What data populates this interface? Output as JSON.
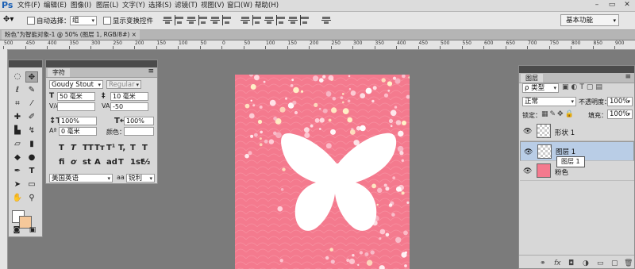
{
  "app": {
    "logo": "Ps"
  },
  "menu": [
    "文件(F)",
    "编辑(E)",
    "图像(I)",
    "图层(L)",
    "文字(Y)",
    "选择(S)",
    "滤镜(T)",
    "视图(V)",
    "窗口(W)",
    "帮助(H)"
  ],
  "window_controls": [
    "–",
    "▭",
    "✕"
  ],
  "options": {
    "auto_select_label": "自动选择：",
    "auto_select_value": "组",
    "transform_label": "显示变换控件",
    "workspace": "基本功能"
  },
  "document": {
    "tab": "粉色\"为智能对象-1 @ 50% (图层 1, RGB/8#) ×"
  },
  "ruler_numbers": [
    "500",
    "450",
    "400",
    "350",
    "300",
    "250",
    "200",
    "150",
    "100",
    "50",
    "0",
    "50",
    "100",
    "150",
    "200",
    "250",
    "300",
    "350",
    "400",
    "450",
    "500",
    "550",
    "600",
    "650",
    "700",
    "750",
    "800",
    "850",
    "900",
    "950"
  ],
  "char_panel": {
    "tab": "字符",
    "font_family": "Goudy Stout",
    "font_style": "Regular",
    "size": "50 毫米",
    "leading": "10 毫米",
    "kerning": "",
    "tracking": "-50",
    "vscale": "100%",
    "hscale": "100%",
    "baseline": "0 毫米",
    "color_label": "颜色：",
    "style_glyphs": [
      "T",
      "T",
      "TT",
      "Tт",
      "T¹",
      "T,",
      "T",
      "T"
    ],
    "opentype_glyphs": [
      "fi",
      "ơ",
      "st",
      "A",
      "ad",
      "T",
      "1st",
      "½"
    ],
    "language": "美国英语",
    "aa_label": "aa",
    "aa_value": "锐利"
  },
  "layers_panel": {
    "tab": "图层",
    "filter": "ρ 类型",
    "blend_mode": "正常",
    "opacity_label": "不透明度：",
    "opacity": "100%",
    "lock_label": "锁定：",
    "fill_label": "填充：",
    "fill": "100%",
    "layers": [
      {
        "name": "形状 1",
        "selected": false
      },
      {
        "name": "图层 1",
        "selected": true
      },
      {
        "name": "粉色",
        "selected": false
      }
    ],
    "tooltip": "图层 1",
    "footer_icons": [
      "link-icon",
      "fx-icon",
      "mask-icon",
      "adjustment-icon",
      "folder-icon",
      "new-layer-icon",
      "trash-icon"
    ]
  },
  "colors": {
    "canvas_pink": "#f47a8e",
    "layer_selected": "#b9cde6",
    "foreground": "#ffffff",
    "background_swatch": "#f5c89a"
  }
}
